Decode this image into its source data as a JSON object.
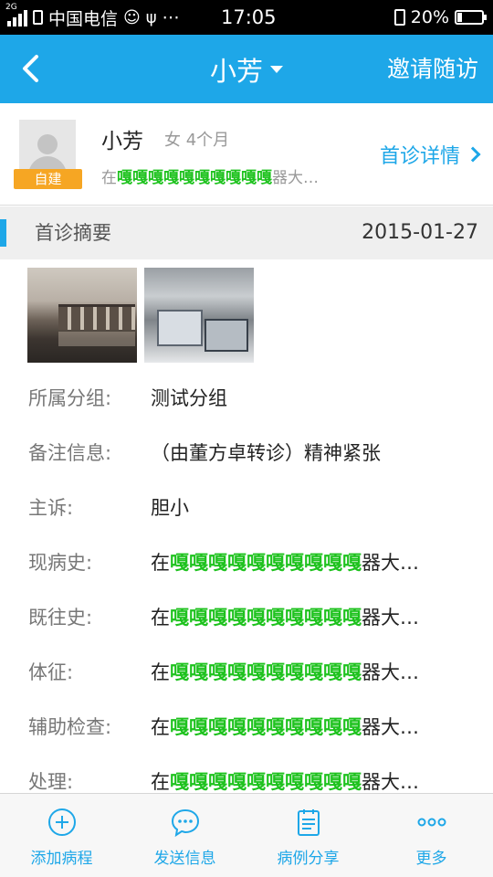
{
  "status_bar": {
    "network": "2G",
    "carrier": "中国电信",
    "time": "17:05",
    "battery": "20%",
    "battery_level": 0.2
  },
  "nav": {
    "title": "小芳",
    "invite": "邀请随访"
  },
  "patient": {
    "badge": "自建",
    "name": "小芳",
    "meta": "女 4个月",
    "desc_prefix": "在",
    "desc_green": "嘎嘎嘎嘎嘎嘎嘎嘎嘎嘎",
    "desc_suffix": "器大…",
    "detail_link": "首诊详情"
  },
  "section": {
    "label": "首诊摘要",
    "date": "2015-01-27"
  },
  "fields": [
    {
      "key": "所属分组:",
      "value": "测试分组"
    },
    {
      "key": "备注信息:",
      "value": "（由董方卓转诊）精神紧张"
    },
    {
      "key": "主诉:",
      "value": "胆小"
    },
    {
      "key": "现病史:",
      "prefix": "在",
      "green": "嘎嘎嘎嘎嘎嘎嘎嘎嘎嘎",
      "suffix": "器大…"
    },
    {
      "key": "既往史:",
      "prefix": "在",
      "green": "嘎嘎嘎嘎嘎嘎嘎嘎嘎嘎",
      "suffix": "器大…"
    },
    {
      "key": "体征:",
      "prefix": "在",
      "green": "嘎嘎嘎嘎嘎嘎嘎嘎嘎嘎",
      "suffix": "器大…"
    },
    {
      "key": "辅助检查:",
      "prefix": "在",
      "green": "嘎嘎嘎嘎嘎嘎嘎嘎嘎嘎",
      "suffix": "器大…"
    },
    {
      "key": "处理:",
      "prefix": "在",
      "green": "嘎嘎嘎嘎嘎嘎嘎嘎嘎嘎",
      "suffix": "器大…"
    }
  ],
  "tabs": [
    {
      "label": "添加病程",
      "icon": "plus-circle-icon"
    },
    {
      "label": "发送信息",
      "icon": "chat-bubble-icon"
    },
    {
      "label": "病例分享",
      "icon": "clipboard-icon"
    },
    {
      "label": "更多",
      "icon": "more-dots-icon"
    }
  ],
  "colors": {
    "accent": "#1ea7e8",
    "badge": "#f6a623",
    "highlight_text": "#1ec21e"
  }
}
